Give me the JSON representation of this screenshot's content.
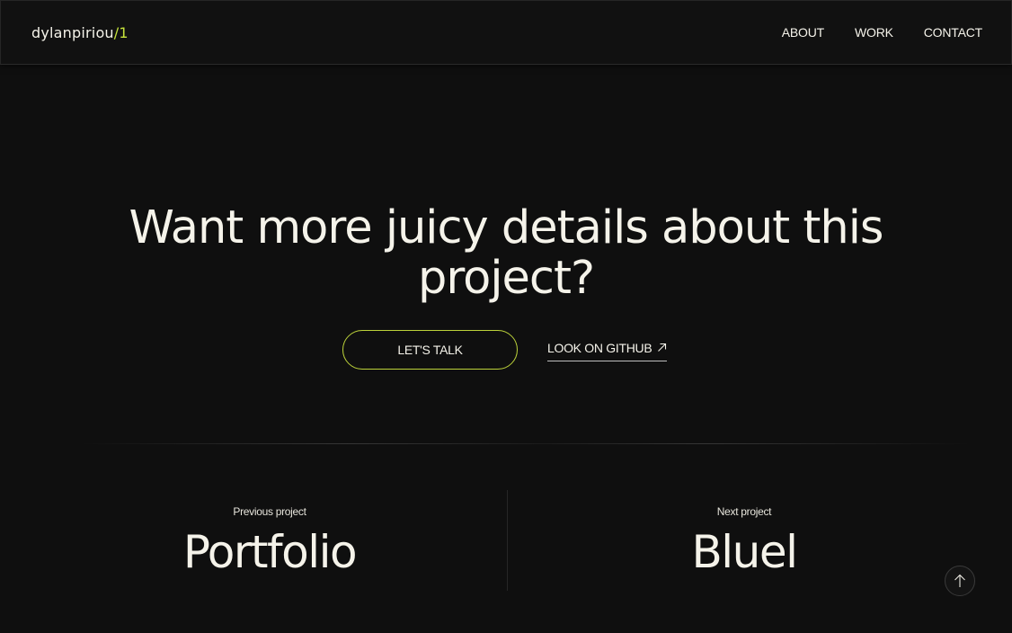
{
  "header": {
    "brand": "dylanpiriou",
    "brand_accent": "/1",
    "nav": [
      {
        "label": "ABOUT"
      },
      {
        "label": "WORK"
      },
      {
        "label": "CONTACT"
      }
    ]
  },
  "hero": {
    "headline_line1": "Want more juicy details about this",
    "headline_line2": "project?",
    "cta_primary": "LET'S TALK",
    "cta_secondary": "LOOK ON GITHUB",
    "cta_secondary_icon": "arrow-up-right-icon"
  },
  "projects": {
    "previous_label": "Previous project",
    "previous_title": "Portfolio",
    "next_label": "Next project",
    "next_title": "Bluel"
  },
  "back_to_top_icon": "arrow-up-icon",
  "colors": {
    "background": "#0f0f0f",
    "text": "#f5f3ea",
    "accent": "#c7e43b"
  }
}
